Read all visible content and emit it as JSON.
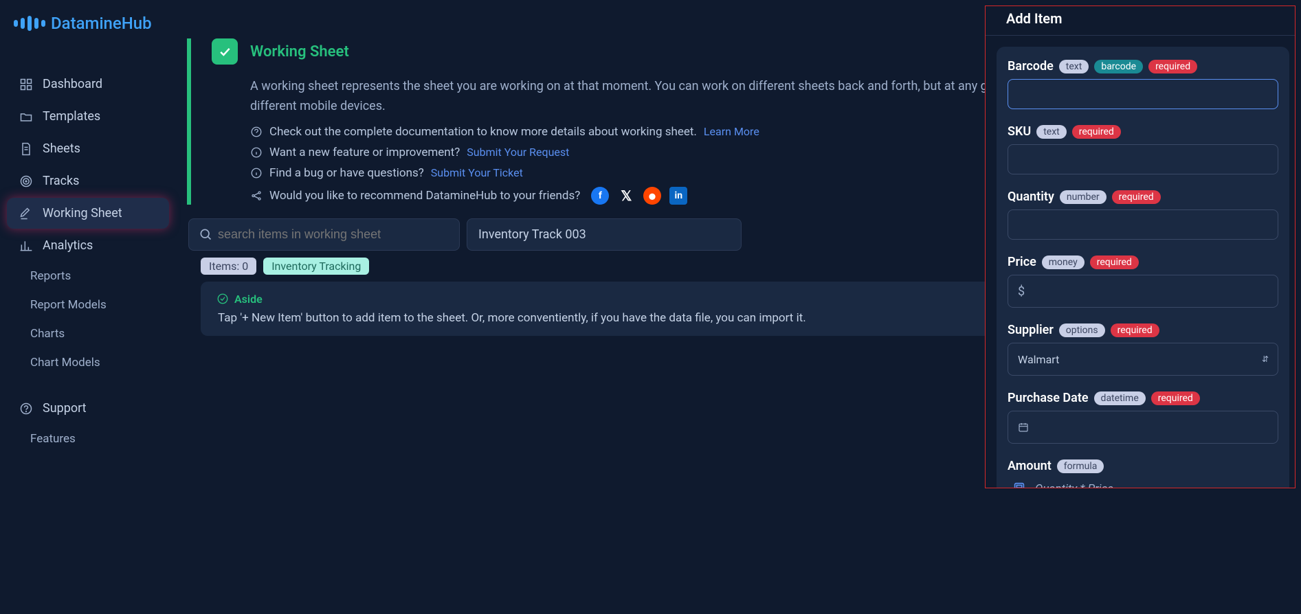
{
  "brand": "DatamineHub",
  "sidebar": {
    "items": [
      {
        "label": "Dashboard",
        "icon": "grid"
      },
      {
        "label": "Templates",
        "icon": "folder"
      },
      {
        "label": "Sheets",
        "icon": "file"
      },
      {
        "label": "Tracks",
        "icon": "target"
      },
      {
        "label": "Working Sheet",
        "icon": "edit",
        "active": true
      },
      {
        "label": "Analytics",
        "icon": "chart"
      }
    ],
    "sub": [
      {
        "label": "Reports"
      },
      {
        "label": "Report Models"
      },
      {
        "label": "Charts"
      },
      {
        "label": "Chart Models"
      }
    ],
    "support": "Support",
    "features": "Features"
  },
  "hero": {
    "title": "Working Sheet",
    "desc": "A working sheet represents the sheet you are working on at that moment. You can work on different sheets back and forth, but at any given time, you can only work on one sheet, even across different mobile devices.",
    "line1_text": "Check out the complete documentation to know more details about working sheet.",
    "line1_link": "Learn More",
    "line2_text": "Want a new feature or improvement?",
    "line2_link": "Submit Your Request",
    "line3_text": "Find a bug or have questions?",
    "line3_link": "Submit Your Ticket",
    "share_text": "Would you like to recommend DatamineHub to your friends?"
  },
  "controls": {
    "search_placeholder": "search items in working sheet",
    "track_label": "Inventory Track 003"
  },
  "pills": {
    "items": "Items: 0",
    "inventory": "Inventory Tracking"
  },
  "aside": {
    "title": "Aside",
    "body": "Tap '+ New Item' button to add item to the sheet. Or, more conventiently, if you have the data file, you can import it."
  },
  "panel": {
    "title": "Add Item",
    "fields": {
      "barcode": {
        "label": "Barcode",
        "type": "text",
        "extra": "barcode",
        "required": "required"
      },
      "sku": {
        "label": "SKU",
        "type": "text",
        "required": "required"
      },
      "quantity": {
        "label": "Quantity",
        "type": "number",
        "required": "required"
      },
      "price": {
        "label": "Price",
        "type": "money",
        "required": "required",
        "prefix": "$"
      },
      "supplier": {
        "label": "Supplier",
        "type": "options",
        "required": "required",
        "value": "Walmart"
      },
      "purchase_date": {
        "label": "Purchase Date",
        "type": "datetime",
        "required": "required"
      },
      "amount": {
        "label": "Amount",
        "type": "formula",
        "formula": "Quantity * Price"
      }
    }
  }
}
